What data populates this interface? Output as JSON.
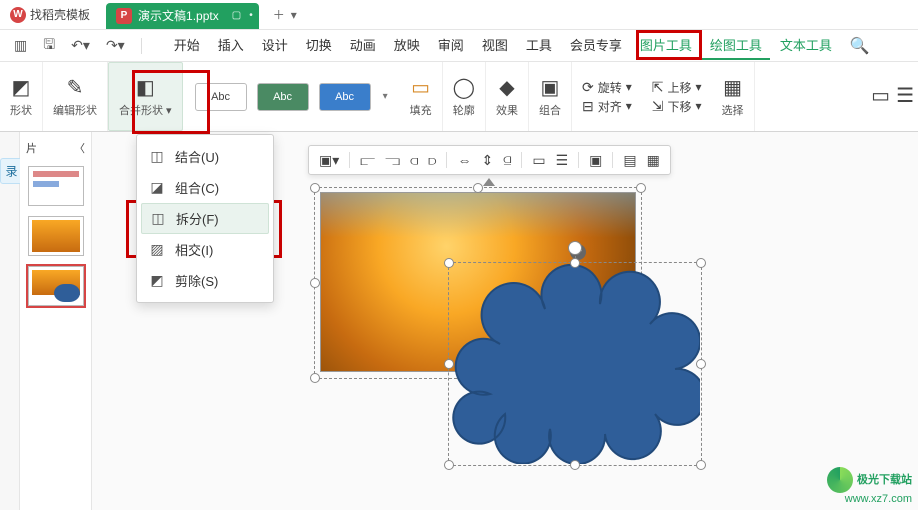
{
  "title_tab": {
    "template_label": "找稻壳模板",
    "file_name": "演示文稿1.pptx"
  },
  "menu": {
    "items": [
      "开始",
      "插入",
      "设计",
      "切换",
      "动画",
      "放映",
      "审阅",
      "视图",
      "工具",
      "会员专享"
    ],
    "context": [
      "图片工具",
      "绘图工具",
      "文本工具"
    ]
  },
  "ribbon": {
    "shape_btn": "形状",
    "edit_shape_btn": "编辑形状",
    "merge_btn": "合并形状",
    "styles_label": "Abc",
    "fill": "填充",
    "outline": "轮廓",
    "effect": "效果",
    "group": "组合",
    "rotate": "旋转",
    "align": "对齐",
    "move_up": "上移",
    "move_down": "下移",
    "select": "选择"
  },
  "merge_menu": {
    "items": [
      {
        "label": "结合(U)"
      },
      {
        "label": "组合(C)"
      },
      {
        "label": "拆分(F)"
      },
      {
        "label": "相交(I)"
      },
      {
        "label": "剪除(S)"
      }
    ],
    "highlight_index": 2
  },
  "sidebar": {
    "collapse_char": "〈",
    "outline_label": "录",
    "slide_header": "片"
  },
  "watermark": {
    "name": "极光下载站",
    "url": "www.xz7.com"
  }
}
